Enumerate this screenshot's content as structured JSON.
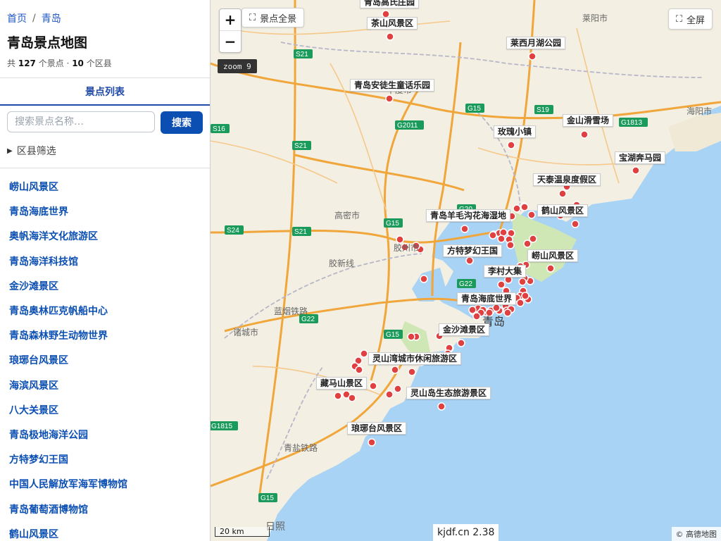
{
  "breadcrumb": {
    "home": "首页",
    "sep": "/",
    "current": "青岛"
  },
  "page_title": "青岛景点地图",
  "stats": {
    "prefix": "共",
    "spots": "127",
    "spots_unit": "个景点 ·",
    "districts": "10",
    "districts_unit": "个区县"
  },
  "tab_label": "景点列表",
  "search": {
    "placeholder": "搜索景点名称…",
    "button": "搜索"
  },
  "filter_label": "区县筛选",
  "spots": [
    "崂山风景区",
    "青岛海底世界",
    "奥帆海洋文化旅游区",
    "青岛海洋科技馆",
    "金沙滩景区",
    "青岛奥林匹克帆船中心",
    "青岛森林野生动物世界",
    "琅琊台风景区",
    "海滨风景区",
    "八大关景区",
    "青岛极地海洋公园",
    "方特梦幻王国",
    "中国人民解放军海军博物馆",
    "青岛葡萄酒博物馆",
    "鹤山风景区"
  ],
  "map": {
    "zoom_in": "+",
    "zoom_out": "−",
    "full_extent": "景点全景",
    "fullscreen": "全屏",
    "zoom_level": "zoom 9",
    "scale": "20 km",
    "copyright": "© 高德地图",
    "version": "kjdf.cn 2.38",
    "map_labels": [
      "青岛高氏庄园",
      "茶山风景区",
      "莱西月湖公园",
      "青岛安徒生童话乐园",
      "玫瑰小镇",
      "金山滑雪场",
      "宝湖奔马园",
      "天泰温泉度假区",
      "鹤山风景区",
      "青岛羊毛沟花海湿地",
      "方特梦幻王国",
      "崂山风景区",
      "李村大集",
      "青岛海底世界",
      "金沙滩景区",
      "灵山湾城市休闲旅游区",
      "藏马山景区",
      "灵山岛生态旅游景区",
      "琅琊台风景区"
    ],
    "basemap_text": [
      "平度市",
      "高密市",
      "胶州市",
      "诸城市",
      "青岛",
      "莱阳市",
      "海阳市",
      "日照",
      "胶新线",
      "蓝烟铁路",
      "青盐铁路"
    ],
    "road_shields": [
      "S16",
      "S21",
      "S21",
      "S21",
      "S24",
      "G15",
      "G15",
      "G15",
      "G20",
      "G22",
      "G22",
      "S19",
      "G1813",
      "G2011",
      "G1815",
      "G15"
    ],
    "colors": {
      "water": "#a9d3f5",
      "land": "#f3efe2",
      "highway": "#f0a63a",
      "marker": "#e04040",
      "forest": "#cfe6b5"
    }
  }
}
